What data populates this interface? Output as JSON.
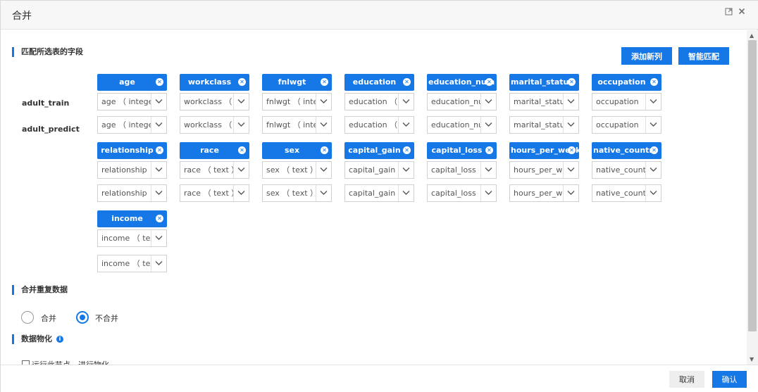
{
  "dialog": {
    "title": "合并",
    "maximize_icon": "maximize-icon",
    "close_icon": "close-icon"
  },
  "section_fields": {
    "title": "匹配所选表的字段"
  },
  "buttons": {
    "add_column": "添加新列",
    "smart_match": "智能匹配"
  },
  "rows": {
    "train": "adult_train",
    "predict": "adult_predict"
  },
  "columns": [
    {
      "name": "age",
      "train": "age （ integer ）",
      "predict": "age （ integer ）"
    },
    {
      "name": "workclass",
      "train": "workclass （ text ）",
      "predict": "workclass （ text ）"
    },
    {
      "name": "fnlwgt",
      "train": "fnlwgt （ integer ）",
      "predict": "fnlwgt （ integer ）"
    },
    {
      "name": "education",
      "train": "education （ text ）",
      "predict": "education （ text ）"
    },
    {
      "name": "education_num",
      "train": "education_num",
      "predict": "education_num"
    },
    {
      "name": "marital_status",
      "train": "marital_status",
      "predict": "marital_status"
    },
    {
      "name": "occupation",
      "train": "occupation （ text ）",
      "predict": "occupation （ text ）"
    },
    {
      "name": "relationship",
      "train": "relationship （ text ）",
      "predict": "relationship （ text ）"
    },
    {
      "name": "race",
      "train": "race （ text ）",
      "predict": "race （ text ）"
    },
    {
      "name": "sex",
      "train": "sex （ text ）",
      "predict": "sex （ text ）"
    },
    {
      "name": "capital_gain",
      "train": "capital_gain （ integer ）",
      "predict": "capital_gain （ integer ）"
    },
    {
      "name": "capital_loss",
      "train": "capital_loss （ integer ）",
      "predict": "capital_loss （ integer ）"
    },
    {
      "name": "hours_per_week",
      "train": "hours_per_week",
      "predict": "hours_per_week"
    },
    {
      "name": "native_country",
      "train": "native_country",
      "predict": "native_country"
    },
    {
      "name": "income",
      "train": "income （ text ）",
      "predict": "income （ text ）"
    }
  ],
  "section_merge": {
    "title": "合并重复数据",
    "option_merge": "合并",
    "option_no_merge": "不合并",
    "selected": "不合并"
  },
  "section_materialize": {
    "title": "数据物化",
    "info_icon": "info-icon",
    "checkbox_label": "运行此节点，进行物化",
    "checked": false
  },
  "footer": {
    "cancel": "取消",
    "confirm": "确认"
  },
  "colors": {
    "accent": "#1677e6"
  }
}
